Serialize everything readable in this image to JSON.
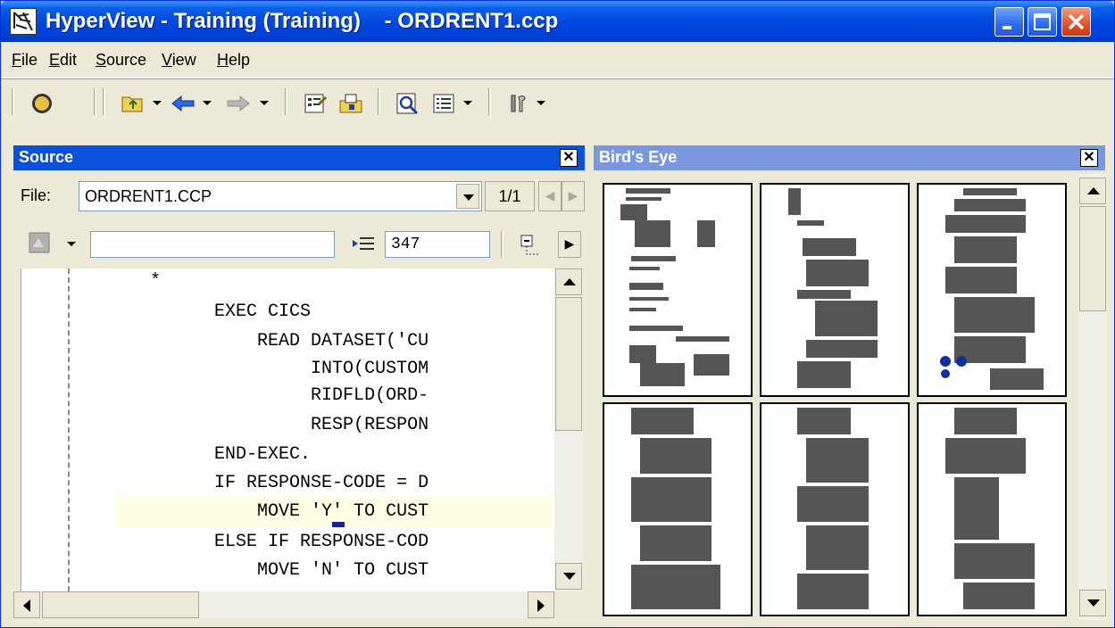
{
  "window": {
    "title": "HyperView - Training (Training)    - ORDRENT1.ccp"
  },
  "menu": [
    "File",
    "Edit",
    "Source",
    "View",
    "Help"
  ],
  "toolbar": {
    "icons": [
      "navigate-icon",
      "open-folder-icon",
      "back-arrow-icon",
      "forward-arrow-icon",
      "properties-icon",
      "repository-icon",
      "search-icon",
      "list-view-icon",
      "tools-icon"
    ]
  },
  "source_panel": {
    "title": "Source",
    "file_label": "File:",
    "file_value": "ORDRENT1.CCP",
    "page_indicator": "1/1",
    "search_value": "",
    "line_number": "347",
    "code_lines": [
      "            *",
      "                  EXEC CICS",
      "                      READ DATASET('CU",
      "                           INTO(CUSTOM",
      "                           RIDFLD(ORD-",
      "                           RESP(RESPON",
      "                  END-EXEC.",
      "                  IF RESPONSE-CODE = D",
      "                      MOVE 'Y' TO CUST",
      "                  ELSE IF RESPONSE-COD",
      "                      MOVE 'N' TO CUST"
    ]
  },
  "birds_eye_panel": {
    "title": "Bird's Eye"
  },
  "colors": {
    "titlebar": "#0046E0",
    "source_header": "#0A52DD",
    "birds_eye_header": "#7A98E0",
    "highlight": "#FFFFE6"
  }
}
